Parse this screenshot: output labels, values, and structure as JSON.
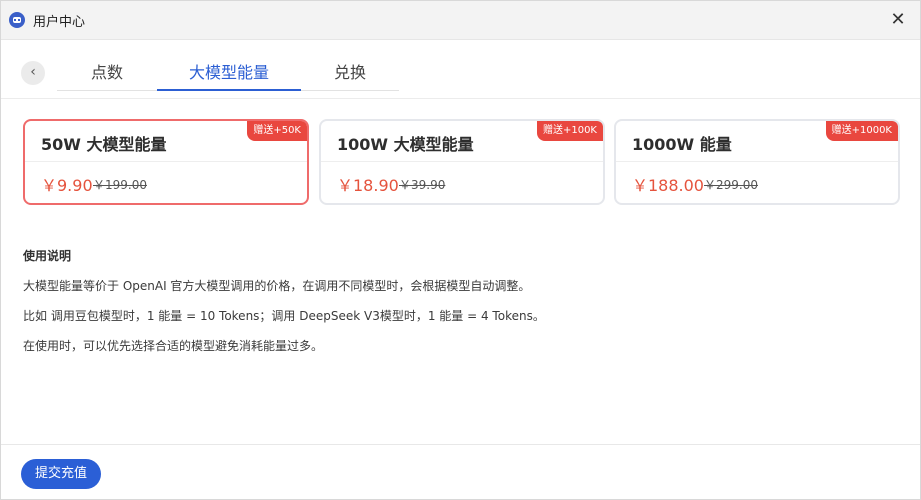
{
  "window": {
    "title": "用户中心",
    "close_glyph": "✕"
  },
  "icons": {
    "app": "app-logo-icon",
    "back": "chevron-left-icon",
    "close": "close-icon"
  },
  "nav": {
    "back_glyph": "‹",
    "tabs": [
      {
        "label": "点数",
        "active": false
      },
      {
        "label": "大模型能量",
        "active": true
      },
      {
        "label": "兑换",
        "active": false
      }
    ]
  },
  "packages": [
    {
      "title": "50W 大模型能量",
      "price": "￥9.90",
      "original_price": "￥199.00",
      "badge": "赠送+50K",
      "selected": true
    },
    {
      "title": "100W 大模型能量",
      "price": "￥18.90",
      "original_price": "￥39.90",
      "badge": "赠送+100K",
      "selected": false
    },
    {
      "title": "1000W 能量",
      "price": "￥188.00",
      "original_price": "￥299.00",
      "badge": "赠送+1000K",
      "selected": false
    }
  ],
  "instructions": {
    "title": "使用说明",
    "lines": [
      "大模型能量等价于 OpenAI 官方大模型调用的价格，在调用不同模型时，会根据模型自动调整。",
      "比如 调用豆包模型时，1 能量 = 10 Tokens；调用 DeepSeek V3模型时，1 能量 = 4 Tokens。",
      "在使用时，可以优先选择合适的模型避免消耗能量过多。"
    ]
  },
  "footer": {
    "submit_label": "提交充值"
  },
  "colors": {
    "accent": "#2c5fd3",
    "price": "#e5533d",
    "badge": "#e9473f",
    "selected_border": "#ef6b6b"
  }
}
